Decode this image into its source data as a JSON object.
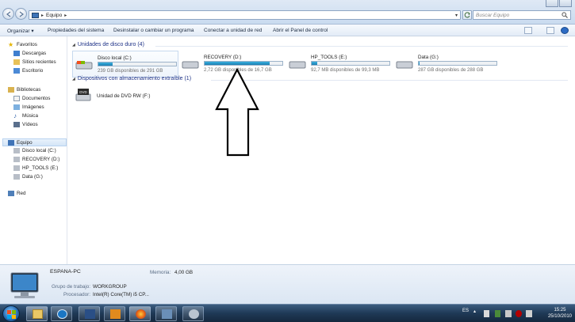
{
  "address_bar": {
    "breadcrumb": [
      "Equipo"
    ],
    "search_placeholder": "Buscar Equipo"
  },
  "toolbar": {
    "organize": "Organizar",
    "items": [
      "Propiedades del sistema",
      "Desinstalar o cambiar un programa",
      "Conectar a unidad de red",
      "Abrir el Panel de control"
    ]
  },
  "nav": {
    "favorites": {
      "label": "Favoritos",
      "items": [
        "Descargas",
        "Sitios recientes",
        "Escritorio"
      ]
    },
    "libraries": {
      "label": "Bibliotecas",
      "items": [
        "Documentos",
        "Imágenes",
        "Música",
        "Vídeos"
      ]
    },
    "computer": {
      "label": "Equipo",
      "items": [
        "Disco local (C:)",
        "RECOVERY (D:)",
        "HP_TOOLS (E:)",
        "Data (G:)"
      ]
    },
    "network": {
      "label": "Red"
    }
  },
  "content": {
    "hdd_group": "Unidades de disco duro (4)",
    "removable_group": "Dispositivos con almacenamiento extraíble (1)",
    "drives": [
      {
        "name": "Disco local (C:)",
        "free_text": "239 GB disponibles de 291 GB",
        "used_fraction": 0.18
      },
      {
        "name": "RECOVERY (D:)",
        "free_text": "2,72 GB disponibles de 16,7 GB",
        "used_fraction": 0.84
      },
      {
        "name": "HP_TOOLS (E:)",
        "free_text": "92,7 MB disponibles de 99,3 MB",
        "used_fraction": 0.07
      },
      {
        "name": "Data (G:)",
        "free_text": "287 GB disponibles de 288 GB",
        "used_fraction": 0.01
      }
    ],
    "dvd": {
      "name": "Unidad de DVD RW (F:)",
      "icon_text": "DVD"
    }
  },
  "details": {
    "pc_name": "ESPANA-PC",
    "memory_label": "Memoria:",
    "memory_value": "4,00 GB",
    "workgroup_label": "Grupo de trabajo:",
    "workgroup_value": "WORKGROUP",
    "processor_label": "Procesador:",
    "processor_value": "Intel(R) Core(TM) i5 CP..."
  },
  "taskbar": {
    "language": "ES",
    "time": "15:25",
    "date": "25/10/2010"
  },
  "colors": {
    "accent": "#1e3287",
    "bar_fill": "#26a0da"
  }
}
